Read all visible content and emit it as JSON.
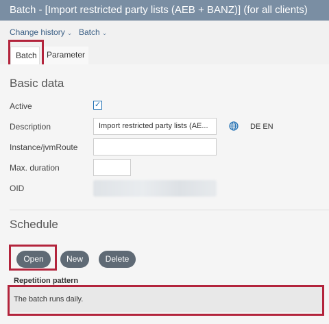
{
  "window": {
    "title": "Batch - [Import restricted party lists (AEB + BANZ)] (for all clients)"
  },
  "menu": {
    "change_history": "Change history",
    "batch": "Batch"
  },
  "tabs": [
    {
      "label": "Batch",
      "active": true
    },
    {
      "label": "Parameter",
      "active": false
    }
  ],
  "basic_data": {
    "title": "Basic data",
    "active_label": "Active",
    "active_checked": true,
    "description_label": "Description",
    "description_value": "Import restricted party lists (AE...",
    "languages": "DE EN",
    "instance_label": "Instance/jvmRoute",
    "instance_value": "",
    "max_duration_label": "Max. duration",
    "max_duration_value": "",
    "oid_label": "OID"
  },
  "schedule": {
    "title": "Schedule",
    "buttons": {
      "open": "Open",
      "new": "New",
      "delete": "Delete"
    },
    "repetition_label": "Repetition pattern",
    "repetition_text": "The batch runs daily."
  },
  "colors": {
    "highlight": "#b3243c",
    "titlebar": "#7a8ea3",
    "accent": "#1f6fb3"
  }
}
